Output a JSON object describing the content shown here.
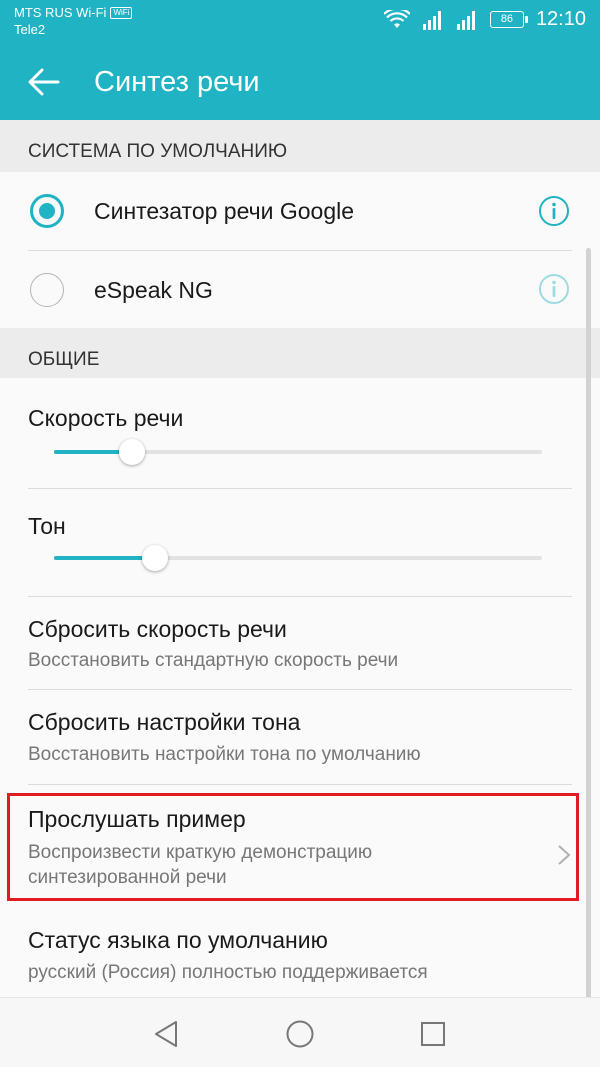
{
  "status_bar": {
    "carrier1": "MTS RUS Wi-Fi",
    "wifi_badge": "WiFi",
    "carrier2": "Tele2",
    "battery": "86",
    "time": "12:10"
  },
  "app_bar": {
    "title": "Синтез речи",
    "back_icon": "arrow-back-icon"
  },
  "sections": {
    "default_system": {
      "header": "СИСТЕМА ПО УМОЛЧАНИЮ",
      "engines": [
        {
          "label": "Синтезатор речи Google",
          "selected": true
        },
        {
          "label": "eSpeak NG",
          "selected": false
        }
      ]
    },
    "general": {
      "header": "ОБЩИЕ",
      "speech_rate": {
        "label": "Скорость речи",
        "value": 0.16
      },
      "pitch": {
        "label": "Тон",
        "value": 0.21
      },
      "reset_rate": {
        "title": "Сбросить скорость речи",
        "subtitle": "Восстановить стандартную скорость речи"
      },
      "reset_pitch": {
        "title": "Сбросить настройки тона",
        "subtitle": "Восстановить настройки тона по умолчанию"
      },
      "listen_example": {
        "title": "Прослушать пример",
        "subtitle_line1": "Воспроизвести краткую демонстрацию",
        "subtitle_line2": "синтезированной речи"
      },
      "language_status": {
        "title": "Статус языка по умолчанию",
        "subtitle": "русский (Россия) полностью поддерживается"
      }
    }
  },
  "colors": {
    "accent": "#1fb3c3",
    "highlight": "#e01b24"
  }
}
